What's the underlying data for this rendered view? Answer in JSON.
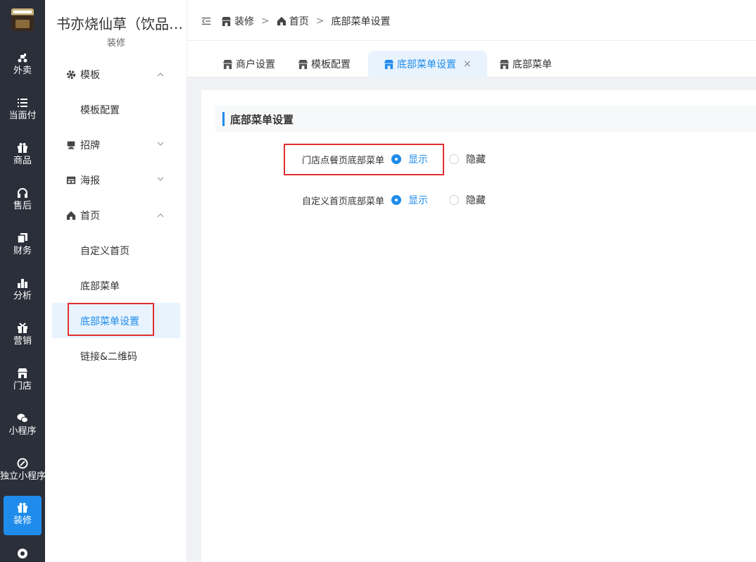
{
  "rail": {
    "items": [
      {
        "label": "外卖",
        "icon": "scooter-icon"
      },
      {
        "label": "当面付",
        "icon": "list-icon"
      },
      {
        "label": "商品",
        "icon": "gift-icon"
      },
      {
        "label": "售后",
        "icon": "headset-icon"
      },
      {
        "label": "财务",
        "icon": "copy-icon"
      },
      {
        "label": "分析",
        "icon": "bar-chart-icon"
      },
      {
        "label": "营销",
        "icon": "present-icon"
      },
      {
        "label": "门店",
        "icon": "store-icon"
      },
      {
        "label": "小程序",
        "icon": "wechat-icon"
      },
      {
        "label": "独立小程序",
        "icon": "link-icon"
      },
      {
        "label": "装修",
        "icon": "decor-icon"
      }
    ]
  },
  "sidebar": {
    "shop_name": "书亦烧仙草（饮品店）",
    "subtitle": "装修",
    "groups": {
      "template": {
        "label": "模板",
        "items": [
          "模板配置"
        ]
      },
      "signboard": {
        "label": "招牌"
      },
      "poster": {
        "label": "海报"
      },
      "home": {
        "label": "首页",
        "items": [
          "自定义首页",
          "底部菜单",
          "底部菜单设置",
          "链接&二维码"
        ]
      }
    }
  },
  "breadcrumb": {
    "items": [
      "装修",
      "首页",
      "底部菜单设置"
    ]
  },
  "tabs": [
    {
      "label": "商户设置"
    },
    {
      "label": "模板配置"
    },
    {
      "label": "底部菜单设置",
      "close": "×"
    },
    {
      "label": "底部菜单"
    }
  ],
  "content": {
    "section_title": "底部菜单设置",
    "rows": [
      {
        "label": "门店点餐页底部菜单",
        "show": "显示",
        "hide": "隐藏",
        "selected": "show"
      },
      {
        "label": "自定义首页底部菜单",
        "show": "显示",
        "hide": "隐藏",
        "selected": "show"
      }
    ]
  },
  "colors": {
    "accent": "#1f8ceb",
    "rail_bg": "#2b2f3a",
    "highlight_red": "#e0302f"
  }
}
